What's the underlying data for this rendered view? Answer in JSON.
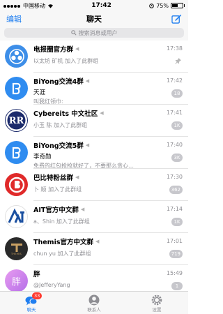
{
  "statusbar": {
    "carrier": "中国移动",
    "time": "17:42",
    "battery": "75%"
  },
  "navbar": {
    "edit": "编辑",
    "title": "聊天"
  },
  "search": {
    "placeholder": "搜索消息或用户"
  },
  "chats": [
    {
      "name": "电报圈官方群",
      "sender": "",
      "preview": "以太坊 矿机 加入了此群组",
      "time": "17:38",
      "badge": "",
      "pinned": true
    },
    {
      "name": "BiYong交流4群",
      "sender": "天涯",
      "preview": "叫我红领巾:",
      "time": "17:42",
      "badge": "18",
      "pinned": false
    },
    {
      "name": "Cybereits 中文社区",
      "sender": "",
      "preview": "小玉 陈 加入了此群组",
      "time": "17:41",
      "badge": "1K",
      "pinned": false
    },
    {
      "name": "BiYong交流5群",
      "sender": "李奇勋",
      "preview": "免费的红包抢抢就好了，不要那么贪心…",
      "time": "17:40",
      "badge": "3K",
      "pinned": false
    },
    {
      "name": "巴比特粉丝群",
      "sender": "",
      "preview": "卜 顺 加入了此群组",
      "time": "17:30",
      "badge": "362",
      "pinned": false
    },
    {
      "name": "AIT官方中文群",
      "sender": "",
      "preview": "a、Shin 加入了此群组",
      "time": "17:14",
      "badge": "1K",
      "pinned": false
    },
    {
      "name": "Themis官方中文群",
      "sender": "",
      "preview": "chun yu 加入了此群组",
      "time": "17:01",
      "badge": "719",
      "pinned": false
    },
    {
      "name": "胖",
      "sender": "",
      "preview": "@JefferyYang",
      "time": "15:49",
      "badge": "1",
      "pinned": false
    }
  ],
  "tabbar": {
    "chats": "聊天",
    "chats_badge": "33",
    "contacts": "联系人",
    "settings": "设置"
  },
  "avatars": {
    "themis_text": "THEMIS",
    "avatar_fat_char": "胖"
  },
  "colors": {
    "accent": "#1f7ef0",
    "badge_gray": "#c7c7cc",
    "badge_red": "#ff3b30"
  }
}
